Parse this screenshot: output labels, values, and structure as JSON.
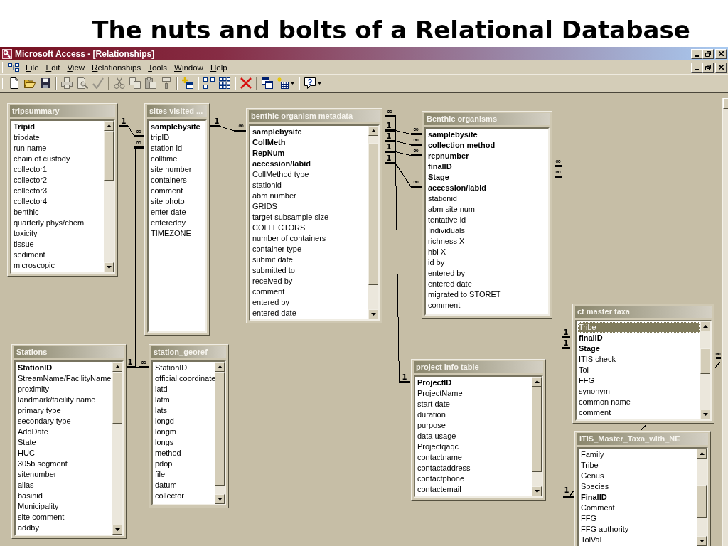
{
  "slide_title": "The nuts and bolts of a Relational Database",
  "window": {
    "title": "Microsoft Access - [Relationships]"
  },
  "menu": [
    "File",
    "Edit",
    "View",
    "Relationships",
    "Tools",
    "Window",
    "Help"
  ],
  "toolbar": [
    [
      {
        "kind": "button",
        "disabled": false
      },
      {
        "kind": "button",
        "disabled": false
      },
      {
        "kind": "button",
        "disabled": false
      }
    ],
    [
      {
        "kind": "button",
        "disabled": true
      },
      {
        "kind": "button",
        "disabled": true
      },
      {
        "kind": "button",
        "disabled": true
      }
    ],
    [
      {
        "kind": "button",
        "disabled": true
      },
      {
        "kind": "button",
        "disabled": true
      },
      {
        "kind": "button",
        "disabled": true
      },
      {
        "kind": "button",
        "disabled": true
      }
    ],
    [
      {
        "kind": "button",
        "disabled": false
      }
    ],
    [
      {
        "kind": "button",
        "disabled": false
      },
      {
        "kind": "button",
        "disabled": false
      }
    ],
    [
      {
        "kind": "button",
        "disabled": false
      }
    ],
    [
      {
        "kind": "button",
        "disabled": false
      },
      {
        "kind": "dropdown",
        "disabled": false
      }
    ],
    [
      {
        "kind": "dropdown",
        "disabled": false
      }
    ]
  ],
  "tables": [
    {
      "title": "tripsummary",
      "scrollable": true,
      "fields": [
        {
          "name": "Tripid",
          "key": true,
          "selected": false
        },
        {
          "name": "tripdate",
          "key": false,
          "selected": false
        },
        {
          "name": "run name",
          "key": false,
          "selected": false
        },
        {
          "name": "chain of custody",
          "key": false,
          "selected": false
        },
        {
          "name": "collector1",
          "key": false,
          "selected": false
        },
        {
          "name": "collector2",
          "key": false,
          "selected": false
        },
        {
          "name": "collector3",
          "key": false,
          "selected": false
        },
        {
          "name": "collector4",
          "key": false,
          "selected": false
        },
        {
          "name": "benthic",
          "key": false,
          "selected": false
        },
        {
          "name": "quarterly phys/chem",
          "key": false,
          "selected": false
        },
        {
          "name": "toxicity",
          "key": false,
          "selected": false
        },
        {
          "name": "tissue",
          "key": false,
          "selected": false
        },
        {
          "name": "sediment",
          "key": false,
          "selected": false
        },
        {
          "name": "microscopic",
          "key": false,
          "selected": false
        }
      ]
    },
    {
      "title": "sites visited ...",
      "scrollable": false,
      "fields": [
        {
          "name": "samplebysite",
          "key": true,
          "selected": false
        },
        {
          "name": "tripID",
          "key": false,
          "selected": false
        },
        {
          "name": "station id",
          "key": false,
          "selected": false
        },
        {
          "name": "colltime",
          "key": false,
          "selected": false
        },
        {
          "name": "site number",
          "key": false,
          "selected": false
        },
        {
          "name": "containers",
          "key": false,
          "selected": false
        },
        {
          "name": "comment",
          "key": false,
          "selected": false
        },
        {
          "name": "site photo",
          "key": false,
          "selected": false
        },
        {
          "name": "enter date",
          "key": false,
          "selected": false
        },
        {
          "name": "enteredby",
          "key": false,
          "selected": false
        },
        {
          "name": "TIMEZONE",
          "key": false,
          "selected": false
        }
      ]
    },
    {
      "title": "benthic organism metadata",
      "scrollable": true,
      "fields": [
        {
          "name": "samplebysite",
          "key": true,
          "selected": false
        },
        {
          "name": "CollMeth",
          "key": true,
          "selected": false
        },
        {
          "name": "RepNum",
          "key": true,
          "selected": false
        },
        {
          "name": "accession/labid",
          "key": true,
          "selected": false
        },
        {
          "name": "CollMethod type",
          "key": false,
          "selected": false
        },
        {
          "name": "stationid",
          "key": false,
          "selected": false
        },
        {
          "name": "abm number",
          "key": false,
          "selected": false
        },
        {
          "name": "GRIDS",
          "key": false,
          "selected": false
        },
        {
          "name": "target subsample size",
          "key": false,
          "selected": false
        },
        {
          "name": "COLLECTORS",
          "key": false,
          "selected": false
        },
        {
          "name": "number of containers",
          "key": false,
          "selected": false
        },
        {
          "name": "container type",
          "key": false,
          "selected": false
        },
        {
          "name": "submit date",
          "key": false,
          "selected": false
        },
        {
          "name": "submitted to",
          "key": false,
          "selected": false
        },
        {
          "name": "received by",
          "key": false,
          "selected": false
        },
        {
          "name": "comment",
          "key": false,
          "selected": false
        },
        {
          "name": "entered by",
          "key": false,
          "selected": false
        },
        {
          "name": "entered date",
          "key": false,
          "selected": false
        }
      ]
    },
    {
      "title": "Benthic organisms",
      "scrollable": false,
      "fields": [
        {
          "name": "samplebysite",
          "key": true,
          "selected": false
        },
        {
          "name": "collection method",
          "key": true,
          "selected": false
        },
        {
          "name": "repnumber",
          "key": true,
          "selected": false
        },
        {
          "name": "finalID",
          "key": true,
          "selected": false
        },
        {
          "name": "Stage",
          "key": true,
          "selected": false
        },
        {
          "name": "accession/labid",
          "key": true,
          "selected": false
        },
        {
          "name": "stationid",
          "key": false,
          "selected": false
        },
        {
          "name": "abm site num",
          "key": false,
          "selected": false
        },
        {
          "name": "tentative id",
          "key": false,
          "selected": false
        },
        {
          "name": "Individuals",
          "key": false,
          "selected": false
        },
        {
          "name": "richness X",
          "key": false,
          "selected": false
        },
        {
          "name": "hbi X",
          "key": false,
          "selected": false
        },
        {
          "name": "id by",
          "key": false,
          "selected": false
        },
        {
          "name": "entered by",
          "key": false,
          "selected": false
        },
        {
          "name": "entered date",
          "key": false,
          "selected": false
        },
        {
          "name": "migrated to STORET",
          "key": false,
          "selected": false
        },
        {
          "name": "comment",
          "key": false,
          "selected": false
        }
      ]
    },
    {
      "title": "Stations",
      "scrollable": true,
      "fields": [
        {
          "name": "StationID",
          "key": true,
          "selected": false
        },
        {
          "name": "StreamName/FacilityName",
          "key": false,
          "selected": false
        },
        {
          "name": "proximity",
          "key": false,
          "selected": false
        },
        {
          "name": "landmark/facility name",
          "key": false,
          "selected": false
        },
        {
          "name": "primary type",
          "key": false,
          "selected": false
        },
        {
          "name": "secondary type",
          "key": false,
          "selected": false
        },
        {
          "name": "AddDate",
          "key": false,
          "selected": false
        },
        {
          "name": "State",
          "key": false,
          "selected": false
        },
        {
          "name": "HUC",
          "key": false,
          "selected": false
        },
        {
          "name": "305b segment",
          "key": false,
          "selected": false
        },
        {
          "name": "sitenumber",
          "key": false,
          "selected": false
        },
        {
          "name": "alias",
          "key": false,
          "selected": false
        },
        {
          "name": "basinid",
          "key": false,
          "selected": false
        },
        {
          "name": "Municipality",
          "key": false,
          "selected": false
        },
        {
          "name": "site comment",
          "key": false,
          "selected": false
        },
        {
          "name": "addby",
          "key": false,
          "selected": false
        }
      ]
    },
    {
      "title": "station_georef",
      "scrollable": true,
      "fields": [
        {
          "name": "StationID",
          "key": false,
          "selected": false
        },
        {
          "name": "official coordinate",
          "key": false,
          "selected": false
        },
        {
          "name": "latd",
          "key": false,
          "selected": false
        },
        {
          "name": "latm",
          "key": false,
          "selected": false
        },
        {
          "name": "lats",
          "key": false,
          "selected": false
        },
        {
          "name": "longd",
          "key": false,
          "selected": false
        },
        {
          "name": "longm",
          "key": false,
          "selected": false
        },
        {
          "name": "longs",
          "key": false,
          "selected": false
        },
        {
          "name": "method",
          "key": false,
          "selected": false
        },
        {
          "name": "pdop",
          "key": false,
          "selected": false
        },
        {
          "name": "file",
          "key": false,
          "selected": false
        },
        {
          "name": "datum",
          "key": false,
          "selected": false
        },
        {
          "name": "collector",
          "key": false,
          "selected": false
        }
      ]
    },
    {
      "title": "project info table",
      "scrollable": true,
      "fields": [
        {
          "name": "ProjectID",
          "key": true,
          "selected": false
        },
        {
          "name": "ProjectName",
          "key": false,
          "selected": false
        },
        {
          "name": "start date",
          "key": false,
          "selected": false
        },
        {
          "name": "duration",
          "key": false,
          "selected": false
        },
        {
          "name": "purpose",
          "key": false,
          "selected": false
        },
        {
          "name": "data usage",
          "key": false,
          "selected": false
        },
        {
          "name": "Projectqaqc",
          "key": false,
          "selected": false
        },
        {
          "name": "contactname",
          "key": false,
          "selected": false
        },
        {
          "name": "contactaddress",
          "key": false,
          "selected": false
        },
        {
          "name": "contactphone",
          "key": false,
          "selected": false
        },
        {
          "name": "contactemail",
          "key": false,
          "selected": false
        }
      ]
    },
    {
      "title": "ct master taxa",
      "scrollable": true,
      "fields": [
        {
          "name": "Tribe",
          "key": false,
          "selected": true
        },
        {
          "name": "finalID",
          "key": true,
          "selected": false
        },
        {
          "name": "Stage",
          "key": true,
          "selected": false
        },
        {
          "name": "ITIS check",
          "key": false,
          "selected": false
        },
        {
          "name": "Tol",
          "key": false,
          "selected": false
        },
        {
          "name": "FFG",
          "key": false,
          "selected": false
        },
        {
          "name": "synonym",
          "key": false,
          "selected": false
        },
        {
          "name": "common name",
          "key": false,
          "selected": false
        },
        {
          "name": "comment",
          "key": false,
          "selected": false
        }
      ]
    },
    {
      "title": "ITIS_Master_Taxa_with_NE",
      "scrollable": true,
      "fields": [
        {
          "name": "Family",
          "key": false,
          "selected": false
        },
        {
          "name": "Tribe",
          "key": false,
          "selected": false
        },
        {
          "name": "Genus",
          "key": false,
          "selected": false
        },
        {
          "name": "Species",
          "key": false,
          "selected": false
        },
        {
          "name": "FinalID",
          "key": true,
          "selected": false
        },
        {
          "name": "Comment",
          "key": false,
          "selected": false
        },
        {
          "name": "FFG",
          "key": false,
          "selected": false
        },
        {
          "name": "FFG authority",
          "key": false,
          "selected": false
        },
        {
          "name": "TolVal",
          "key": false,
          "selected": false
        }
      ]
    }
  ],
  "relationships": [
    {
      "ends": [
        "1",
        "∞"
      ]
    },
    {
      "ends": [
        "∞"
      ]
    },
    {
      "ends": [
        "1",
        "∞"
      ]
    },
    {
      "ends": [
        "1",
        "∞"
      ]
    },
    {
      "ends": [
        "∞"
      ]
    },
    {
      "ends": [
        "1",
        "∞"
      ]
    },
    {
      "ends": [
        "1",
        "∞"
      ]
    },
    {
      "ends": [
        "1",
        "∞"
      ]
    },
    {
      "ends": [
        "1",
        "∞"
      ]
    },
    {
      "ends": [
        "1"
      ]
    },
    {
      "ends": [
        "∞",
        "∞",
        "1",
        "1"
      ]
    },
    {
      "ends": [
        "∞"
      ]
    },
    {
      "ends": [
        "1"
      ]
    }
  ]
}
